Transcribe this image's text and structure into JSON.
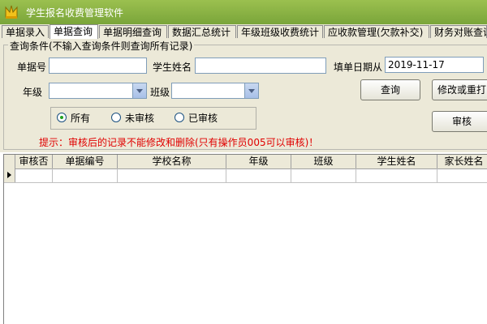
{
  "window": {
    "title": "学生报名收费管理软件"
  },
  "tabs": [
    {
      "label": "单据录入"
    },
    {
      "label": "单据查询"
    },
    {
      "label": "单据明细查询"
    },
    {
      "label": "数据汇总统计"
    },
    {
      "label": "年级班级收费统计"
    },
    {
      "label": "应收款管理(欠款补交)"
    },
    {
      "label": "财务对账查询"
    }
  ],
  "active_tab": 1,
  "query": {
    "legend": "查询条件(不输入查询条件则查询所有记录)",
    "doc_no_label": "单据号",
    "doc_no_value": "",
    "student_name_label": "学生姓名",
    "student_name_value": "",
    "date_from_label": "填单日期从",
    "date_from_value": "2019-11-17",
    "grade_label": "年级",
    "grade_value": "",
    "class_label": "班级",
    "class_value": "",
    "query_button": "查询",
    "edit_button": "修改或重打",
    "audit_button": "审核",
    "filter": {
      "options": [
        "所有",
        "未审核",
        "已审核"
      ],
      "selected": "所有"
    },
    "hint": "提示：审核后的记录不能修改和删除(只有操作员005可以审核)！"
  },
  "table": {
    "columns": [
      "审核否",
      "单据编号",
      "学校名称",
      "年级",
      "班级",
      "学生姓名",
      "家长姓名"
    ],
    "rows": []
  }
}
